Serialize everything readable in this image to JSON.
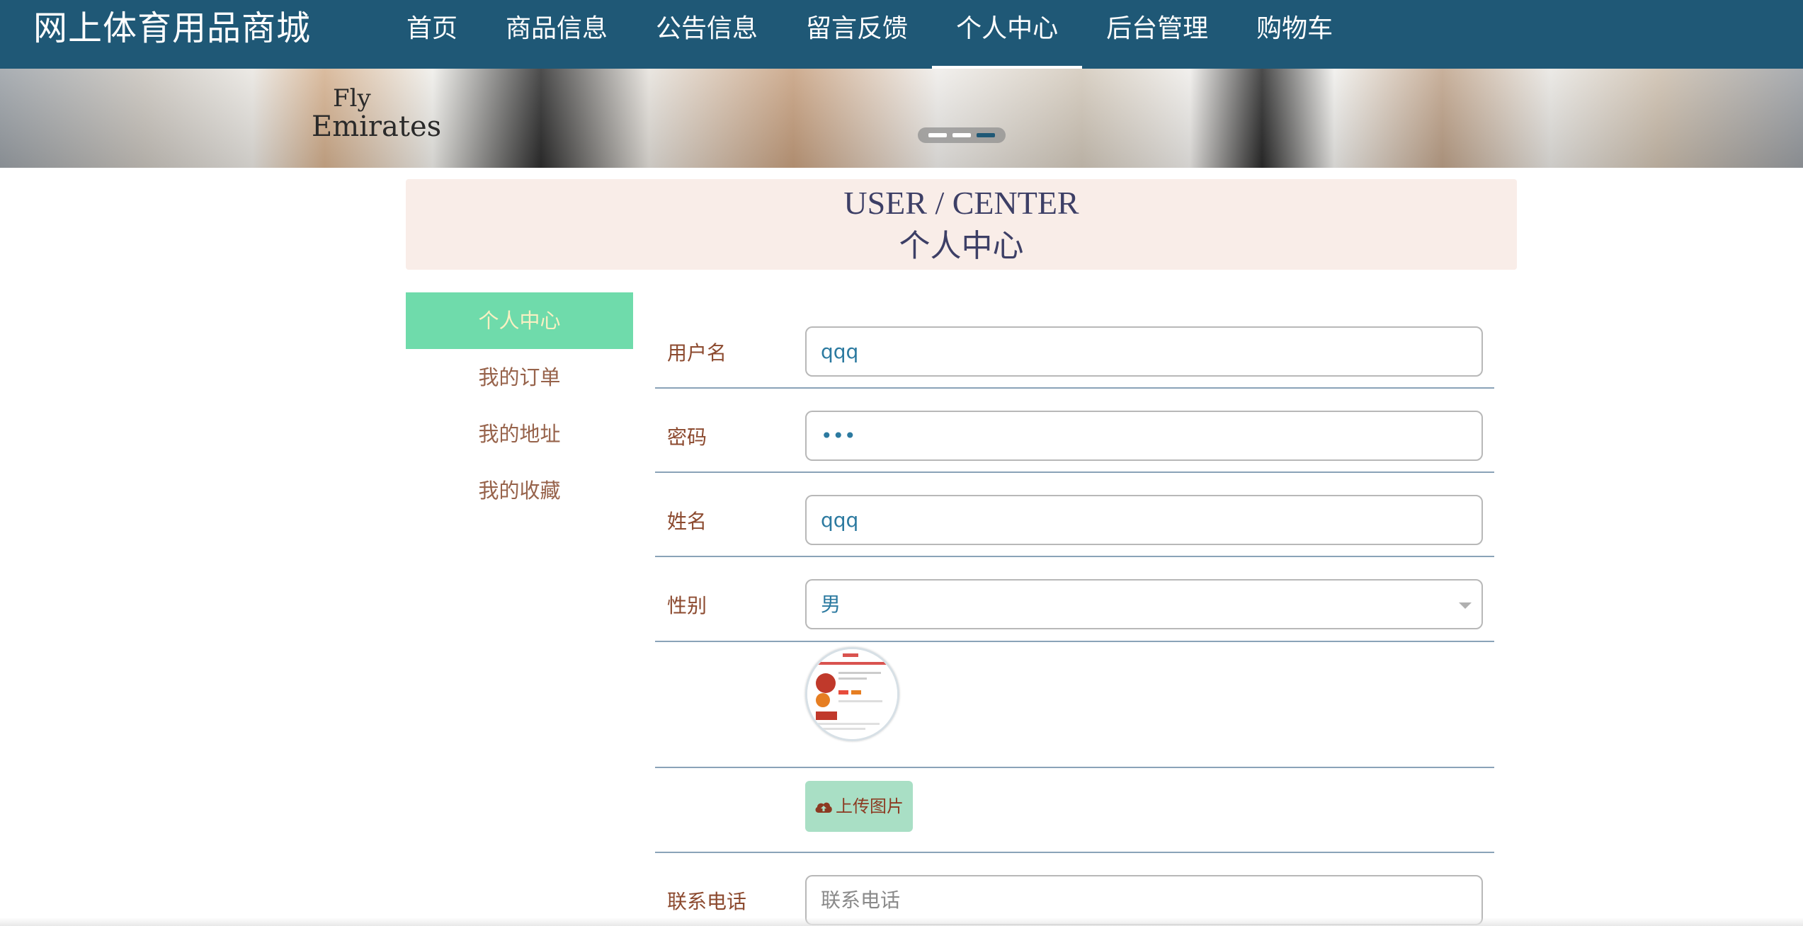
{
  "header": {
    "site_title": "网上体育用品商城",
    "nav": [
      {
        "label": "首页"
      },
      {
        "label": "商品信息"
      },
      {
        "label": "公告信息"
      },
      {
        "label": "留言反馈"
      },
      {
        "label": "个人中心",
        "active": true
      },
      {
        "label": "后台管理"
      },
      {
        "label": "购物车"
      }
    ]
  },
  "banner": {
    "jersey_text_line1": "Fly",
    "jersey_text_line2": "Emirates",
    "active_slide": 3,
    "slide_count": 3
  },
  "section": {
    "title_en": "USER / CENTER",
    "title_cn": "个人中心"
  },
  "sidebar": {
    "items": [
      {
        "label": "个人中心",
        "active": true
      },
      {
        "label": "我的订单"
      },
      {
        "label": "我的地址"
      },
      {
        "label": "我的收藏"
      }
    ]
  },
  "form": {
    "username": {
      "label": "用户名",
      "value": "qqq"
    },
    "password": {
      "label": "密码",
      "value": "•••"
    },
    "name": {
      "label": "姓名",
      "value": "qqq"
    },
    "gender": {
      "label": "性别",
      "value": "男"
    },
    "upload": {
      "label": "上传图片",
      "icon": "cloud-upload-icon"
    },
    "phone": {
      "label": "联系电话",
      "placeholder": "联系电话"
    }
  },
  "colors": {
    "header_bg": "#1f5876",
    "active_sidebar": "#6fdbab",
    "section_bg": "#f9ede8",
    "label_text": "#8c4a2f",
    "value_text": "#2c7aa0"
  }
}
